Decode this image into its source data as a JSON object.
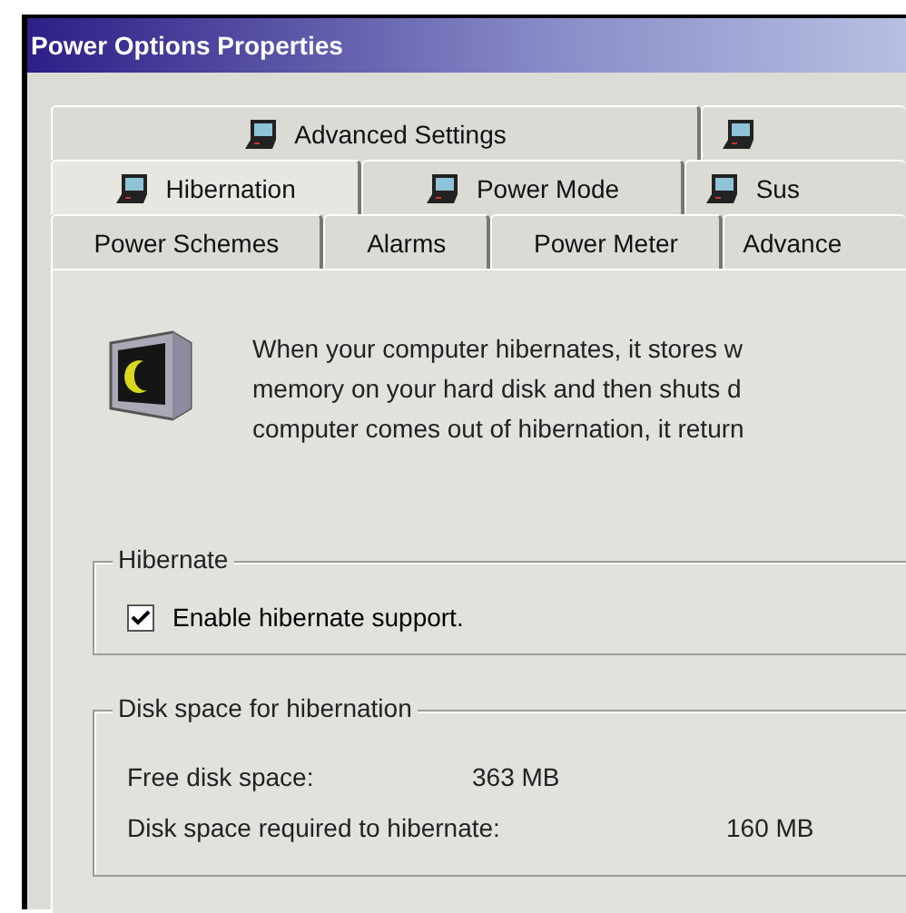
{
  "window": {
    "title": "Power Options Properties"
  },
  "tab_rows": [
    {
      "tabs": [
        {
          "kind": "laptop",
          "label": "Advanced Settings",
          "selected": false
        },
        {
          "kind": "laptop",
          "selected": false
        }
      ]
    },
    {
      "tabs": [
        {
          "kind": "laptop",
          "label": "Hibernation",
          "selected": true
        },
        {
          "kind": "laptop",
          "label": "Power Mode",
          "selected": false
        },
        {
          "kind": "laptop",
          "label": "Sus",
          "selected": false
        }
      ]
    },
    {
      "tabs": [
        {
          "kind": "plain",
          "label": "Power Schemes",
          "selected": false
        },
        {
          "kind": "plain",
          "label": "Alarms",
          "selected": false
        },
        {
          "kind": "plain",
          "label": "Power Meter",
          "selected": false
        },
        {
          "kind": "plain",
          "label": "Advance",
          "selected": false
        }
      ]
    }
  ],
  "description": [
    "When your computer hibernates, it stores w",
    "memory on your hard disk and then shuts d",
    "computer comes out of hibernation, it return"
  ],
  "hibernate_group": {
    "title": "Hibernate",
    "checkbox": {
      "label": "Enable hibernate support.",
      "checked": true
    }
  },
  "disk_group": {
    "title": "Disk space for hibernation",
    "rows": [
      {
        "label": "Free disk space:",
        "value": "363 MB"
      },
      {
        "label": "Disk space required to hibernate:",
        "value": "160 MB"
      }
    ]
  }
}
